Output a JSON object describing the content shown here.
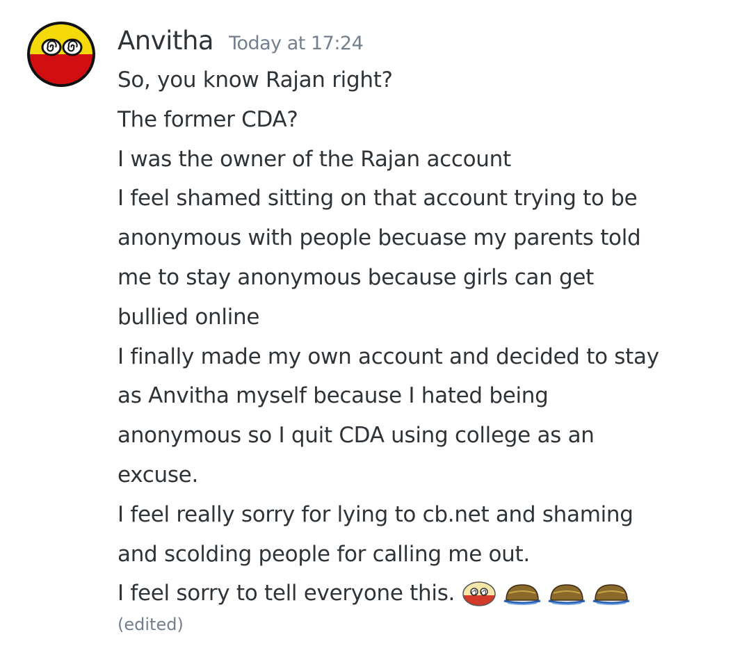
{
  "message": {
    "author": "Anvitha",
    "timestamp": "Today at 17:24",
    "lines": [
      "So, you know Rajan right?",
      "The former CDA?",
      "I was the owner of the Rajan account",
      "I feel shamed sitting on that account trying to be",
      "anonymous with people becuase my parents told",
      "me to stay anonymous because girls can get",
      "bullied online",
      "I finally made my own account and decided to stay",
      "as Anvitha myself because I hated being",
      "anonymous so I quit CDA using college as an",
      "excuse.",
      "I feel really sorry for lying to cb.net and shaming",
      "and scolding people for calling me out.",
      "I feel sorry to tell everyone this."
    ],
    "emojis": [
      "countryball-dizzy-emoji",
      "countryball-melting-emoji",
      "countryball-melting-emoji",
      "countryball-melting-emoji"
    ],
    "edited_label": "(edited)"
  },
  "colors": {
    "text": "#2e3338",
    "muted": "#747f8d",
    "avatar_yellow": "#f5d90a",
    "avatar_red": "#d10f12"
  }
}
